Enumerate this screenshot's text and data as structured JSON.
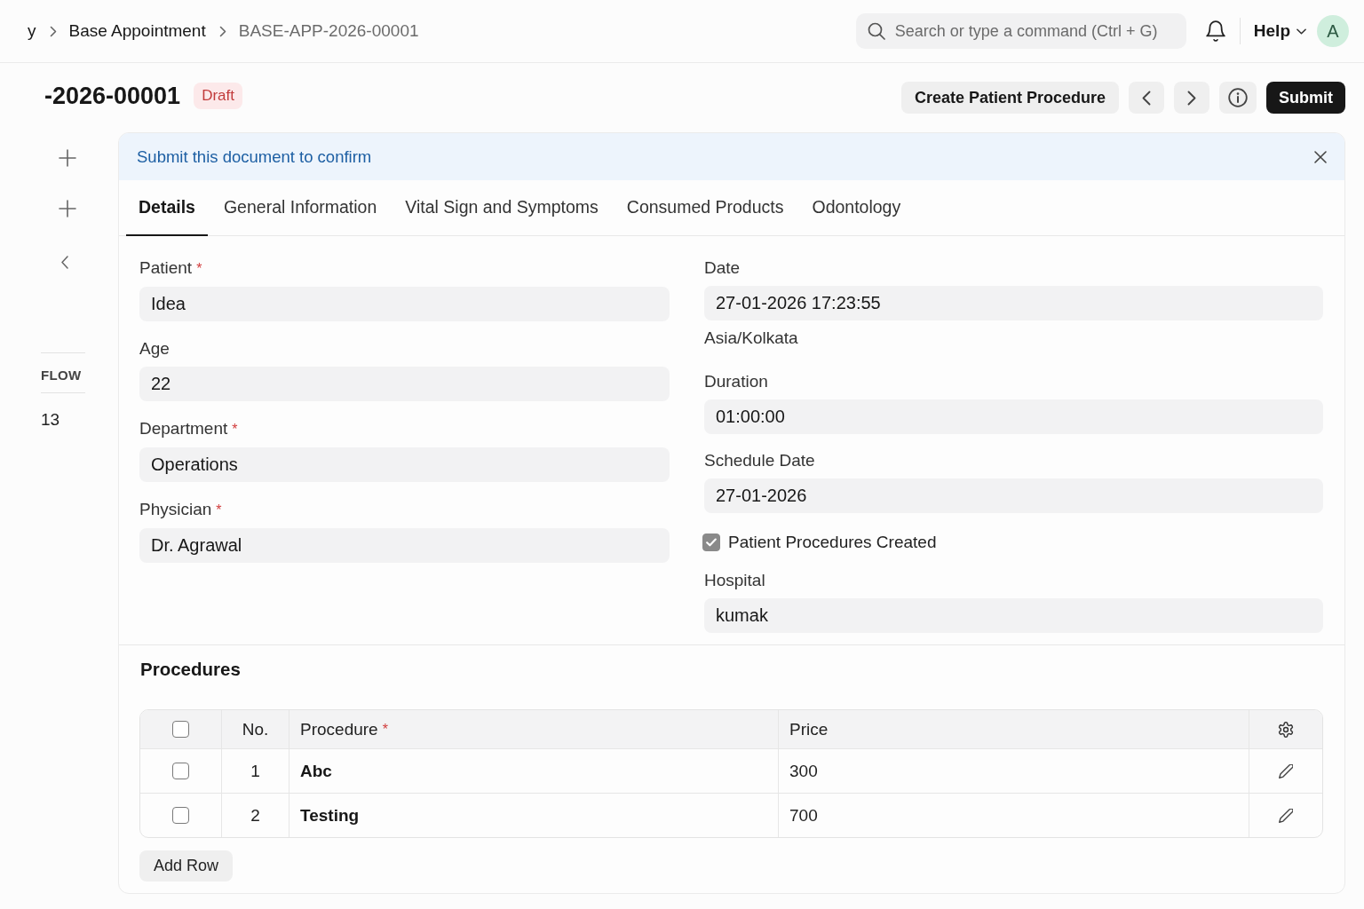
{
  "navbar": {
    "breadcrumbs": [
      {
        "label": "y",
        "current": false
      },
      {
        "label": "Base Appointment",
        "current": false
      },
      {
        "label": "BASE-APP-2026-00001",
        "current": true
      }
    ],
    "search": {
      "placeholder": "Search or type a command (Ctrl + G)"
    },
    "help": "Help",
    "avatar": "A"
  },
  "page_head": {
    "title": "-2026-00001",
    "status": "Draft",
    "actions": [
      {
        "kind": "secondary",
        "label": "Create Patient Procedure"
      },
      {
        "kind": "previous"
      },
      {
        "kind": "next"
      },
      {
        "kind": "info"
      },
      {
        "kind": "primary",
        "label": "Submit"
      }
    ]
  },
  "sidebar": {
    "section": "FLOW",
    "items": [
      "13"
    ]
  },
  "alert": {
    "message": "Submit this document to confirm"
  },
  "tabs": [
    {
      "label": "Details",
      "selected": true
    },
    {
      "label": "General Information",
      "selected": false
    },
    {
      "label": "Vital Sign and Symptoms",
      "selected": false
    },
    {
      "label": "Consumed Products",
      "selected": false
    },
    {
      "label": "Odontology",
      "selected": false
    }
  ],
  "form": {
    "columns": [
      {
        "fields": [
          {
            "kind": "input",
            "label": "Patient",
            "required_mark": "*",
            "value": "Idea"
          },
          {
            "kind": "input",
            "label": "Age",
            "value": "22"
          },
          {
            "kind": "input",
            "label": "Department",
            "required_mark": "*",
            "value": "Operations"
          },
          {
            "kind": "input",
            "label": "Physician",
            "required_mark": "*",
            "value": "Dr. Agrawal"
          }
        ]
      },
      {
        "fields": [
          {
            "kind": "input",
            "label": "Date",
            "value": "27-01-2026 17:23:55",
            "description": "Asia/Kolkata"
          },
          {
            "kind": "input",
            "label": "Duration",
            "value": "01:00:00"
          },
          {
            "kind": "input",
            "label": "Schedule Date",
            "value": "27-01-2026"
          },
          {
            "kind": "checkbox",
            "label": "Patient Procedures Created",
            "checked": true
          },
          {
            "kind": "input",
            "label": "Hospital",
            "value": "kumak"
          }
        ]
      }
    ]
  },
  "procedures": {
    "title": "Procedures",
    "all_selected": false,
    "columns": [
      {
        "kind": "index",
        "label": "No."
      },
      {
        "kind": "link",
        "label": "Procedure",
        "required_mark": "*"
      },
      {
        "kind": "data",
        "label": "Price"
      }
    ],
    "rows": [
      {
        "selected": false,
        "cells": [
          "1",
          "Abc",
          "300"
        ]
      },
      {
        "selected": false,
        "cells": [
          "2",
          "Testing",
          "700"
        ]
      }
    ],
    "add_row": "Add Row"
  }
}
